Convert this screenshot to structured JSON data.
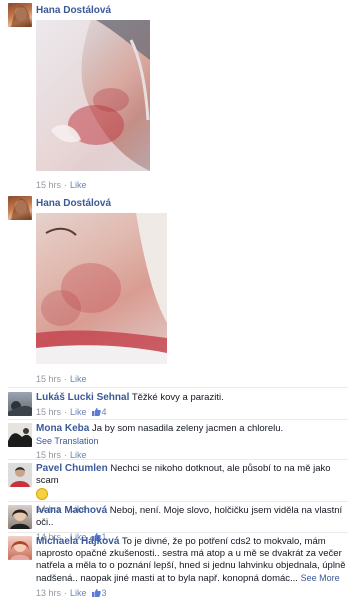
{
  "posts": [
    {
      "author": "Hana Dostálová",
      "time": "15 hrs",
      "like_label": "Like"
    },
    {
      "author": "Hana Dostálová",
      "time": "15 hrs",
      "like_label": "Like"
    }
  ],
  "comments": [
    {
      "author": "Lukáš Lucki Sehnal",
      "text": "Těžké kovy a paraziti.",
      "time": "15 hrs",
      "like_label": "Like",
      "likes": "4"
    },
    {
      "author": "Mona Keba",
      "text": "Ja by som nasadila zeleny jacmen a chlorelu.",
      "see_translation": "See Translation",
      "time": "15 hrs",
      "like_label": "Like"
    },
    {
      "author": "Pavel Chumlen",
      "text": "Nechci se nikoho dotknout, ale působí to na mě jako scam",
      "time": "14 hrs",
      "like_label": "Like"
    },
    {
      "author": "Ivana Machová",
      "text": "Neboj, není. Moje slovo, holčičku jsem viděla na vlastní oči..",
      "time": "14 hrs",
      "like_label": "Like",
      "likes": "1"
    },
    {
      "author": "Michaela Hájková",
      "text": "To je divné, že po potření cds2 to mokvalo, mám naprosto opačné zkušenosti.. sestra má atop a u mě se dvakrát za večer natřela a měla to o poznání lepší, hned si jednu lahvinku objednala, úplně nadšená.. naopak jiné masti at to byla např. konopná domác...",
      "see_more": "See More",
      "time": "13 hrs",
      "like_label": "Like",
      "likes": "3"
    }
  ],
  "colors": {
    "link": "#3b5998",
    "meta": "#9197a3",
    "like": "#6d84b4"
  },
  "icons": {
    "like": "thumbs-up-icon",
    "emoji": "smile-emoji-icon"
  }
}
